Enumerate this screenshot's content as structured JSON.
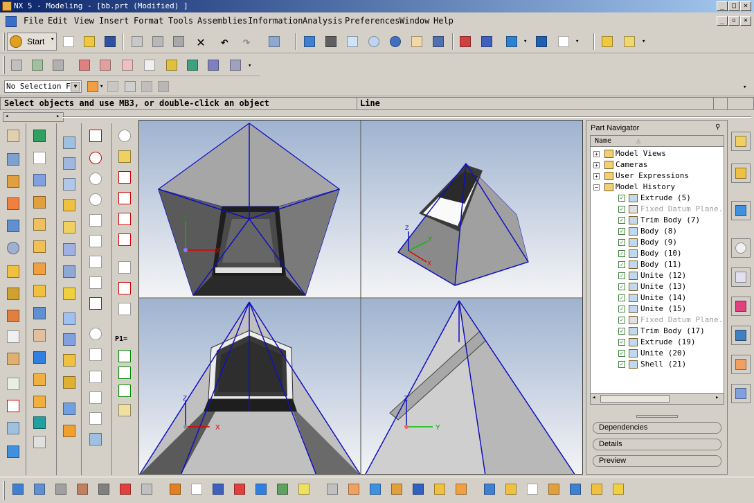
{
  "window": {
    "title": "NX 5 - Modeling - [bb.prt (Modified) ]"
  },
  "menu": {
    "items": [
      "File",
      "Edit",
      "View",
      "Insert",
      "Format",
      "Tools",
      "Assemblies",
      "Information",
      "Analysis",
      "Preferences",
      "Window",
      "Help"
    ]
  },
  "toolbar": {
    "start_label": "Start"
  },
  "selection_filter": {
    "value": "No Selection Fi"
  },
  "cue_line": {
    "prompt": "Select objects and use MB3, or double-click an object",
    "status": "Line"
  },
  "part_navigator": {
    "title": "Part Navigator",
    "column_header": "Name",
    "nodes": [
      {
        "label": "Model Views",
        "level": 0,
        "expanded": false
      },
      {
        "label": "Cameras",
        "level": 0,
        "expanded": false
      },
      {
        "label": "User Expressions",
        "level": 0,
        "expanded": false
      },
      {
        "label": "Model History",
        "level": 0,
        "expanded": true
      },
      {
        "label": "Extrude (5)",
        "level": 1,
        "suppressed": false
      },
      {
        "label": "Fixed Datum Plane...",
        "level": 1,
        "suppressed": true
      },
      {
        "label": "Trim Body (7)",
        "level": 1,
        "suppressed": false
      },
      {
        "label": "Body (8)",
        "level": 1,
        "suppressed": false
      },
      {
        "label": "Body (9)",
        "level": 1,
        "suppressed": false
      },
      {
        "label": "Body (10)",
        "level": 1,
        "suppressed": false
      },
      {
        "label": "Body (11)",
        "level": 1,
        "suppressed": false
      },
      {
        "label": "Unite (12)",
        "level": 1,
        "suppressed": false
      },
      {
        "label": "Unite (13)",
        "level": 1,
        "suppressed": false
      },
      {
        "label": "Unite (14)",
        "level": 1,
        "suppressed": false
      },
      {
        "label": "Unite (15)",
        "level": 1,
        "suppressed": false
      },
      {
        "label": "Fixed Datum Plane...",
        "level": 1,
        "suppressed": true
      },
      {
        "label": "Trim Body (17)",
        "level": 1,
        "suppressed": false
      },
      {
        "label": "Extrude (19)",
        "level": 1,
        "suppressed": false
      },
      {
        "label": "Unite (20)",
        "level": 1,
        "suppressed": false
      },
      {
        "label": "Shell (21)",
        "level": 1,
        "suppressed": false
      }
    ],
    "panels": [
      "Dependencies",
      "Details",
      "Preview"
    ]
  },
  "viewport": {
    "axis_labels": {
      "x": "X",
      "y": "Y",
      "z": "Z"
    },
    "colors": {
      "edge": "#1010c0",
      "bg_top": "#9fb3d0",
      "bg_bottom": "#f4f4f6"
    }
  },
  "sketch_palette": {
    "text": "P1="
  }
}
